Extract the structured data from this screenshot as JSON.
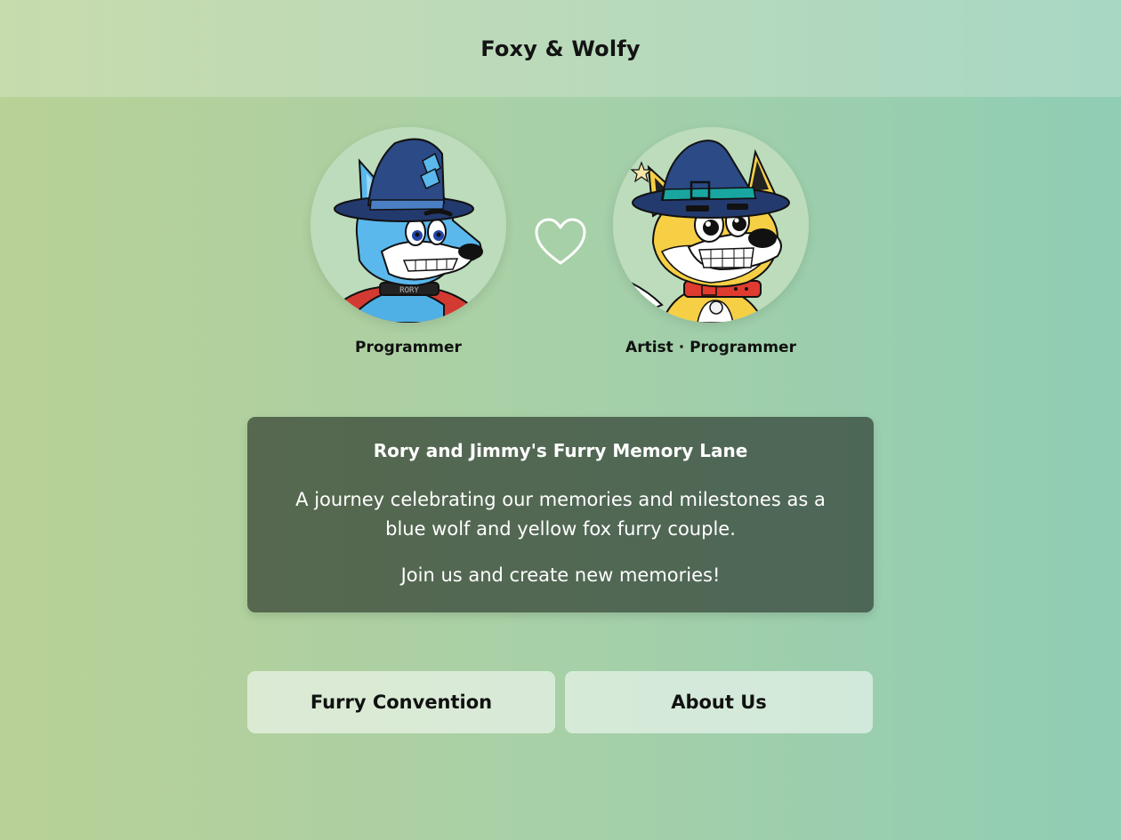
{
  "header": {
    "title": "Foxy & Wolfy"
  },
  "profiles": [
    {
      "role": "Programmer",
      "avatar_icon": "blue-wolf-wizard-avatar"
    },
    {
      "role": "Artist · Programmer",
      "avatar_icon": "yellow-fox-wizard-avatar"
    }
  ],
  "heart_icon": "heart-outline-icon",
  "intro": {
    "title": "Rory and Jimmy's Furry Memory Lane",
    "description": "A journey celebrating our memories and milestones as a blue wolf and yellow fox furry couple.",
    "call_to_action": "Join us and create new memories!"
  },
  "buttons": {
    "convention": "Furry Convention",
    "about": "About Us"
  },
  "colors": {
    "card_background": "#52674f",
    "wolf_fur": "#5ab8ec",
    "fox_fur": "#f6cf45",
    "hat": "#233a6e"
  }
}
